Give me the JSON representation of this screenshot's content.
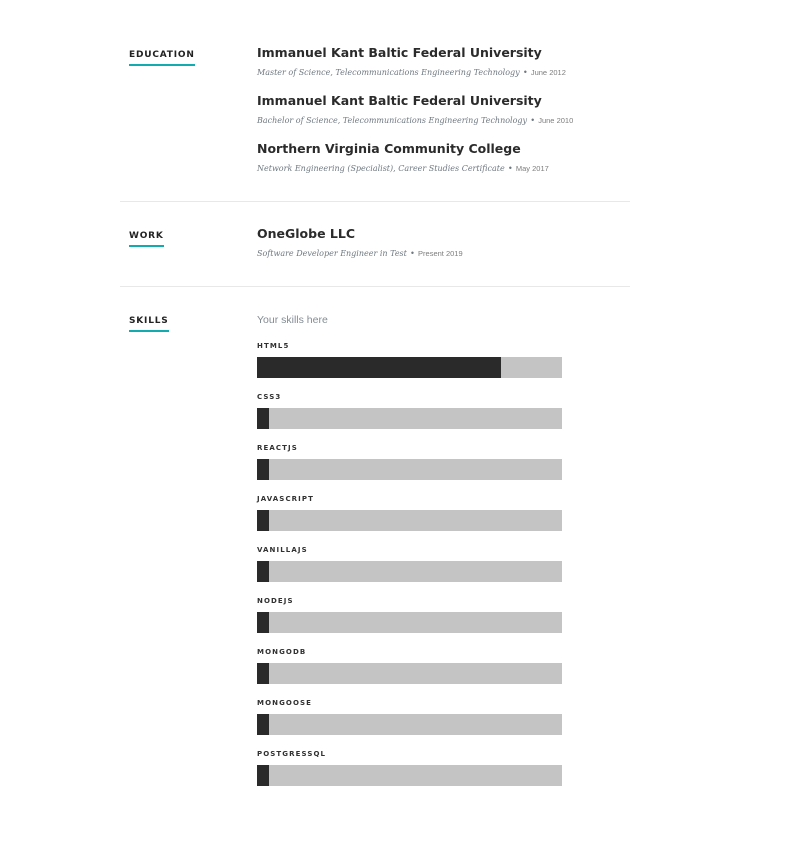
{
  "education": {
    "label": "EDUCATION",
    "entries": [
      {
        "school": "Immanuel Kant Baltic Federal University",
        "degree": "Master of Science, Telecommunications Engineering Technology",
        "bullet": "•",
        "date": "June 2012"
      },
      {
        "school": "Immanuel Kant Baltic Federal University",
        "degree": "Bachelor of Science, Telecommunications Engineering Technology",
        "bullet": "•",
        "date": "June 2010"
      },
      {
        "school": "Northern Virginia Community College",
        "degree": "Network Engineering (Specialist), Career Studies Certificate",
        "bullet": "•",
        "date": "May 2017"
      }
    ]
  },
  "work": {
    "label": "WORK",
    "entries": [
      {
        "company": "OneGlobe LLC",
        "title": "Software Developer Engineer in Test",
        "bullet": "•",
        "date": "Present 2019"
      }
    ]
  },
  "skills": {
    "label": "SKILLS",
    "intro": "Your skills here",
    "colors": {
      "fill": "#2a2a2a",
      "track": "#c4c4c4",
      "underline": "#11abb0"
    },
    "items": [
      {
        "name": "HTML5",
        "level": 0.8
      },
      {
        "name": "CSS3",
        "level": 0.04
      },
      {
        "name": "REACTJS",
        "level": 0.04
      },
      {
        "name": "JAVASCRIPT",
        "level": 0.04
      },
      {
        "name": "VANILLAJS",
        "level": 0.04
      },
      {
        "name": "NODEJS",
        "level": 0.04
      },
      {
        "name": "MONGODB",
        "level": 0.04
      },
      {
        "name": "MONGOOSE",
        "level": 0.04
      },
      {
        "name": "POSTGRESSQL",
        "level": 0.04
      }
    ]
  }
}
